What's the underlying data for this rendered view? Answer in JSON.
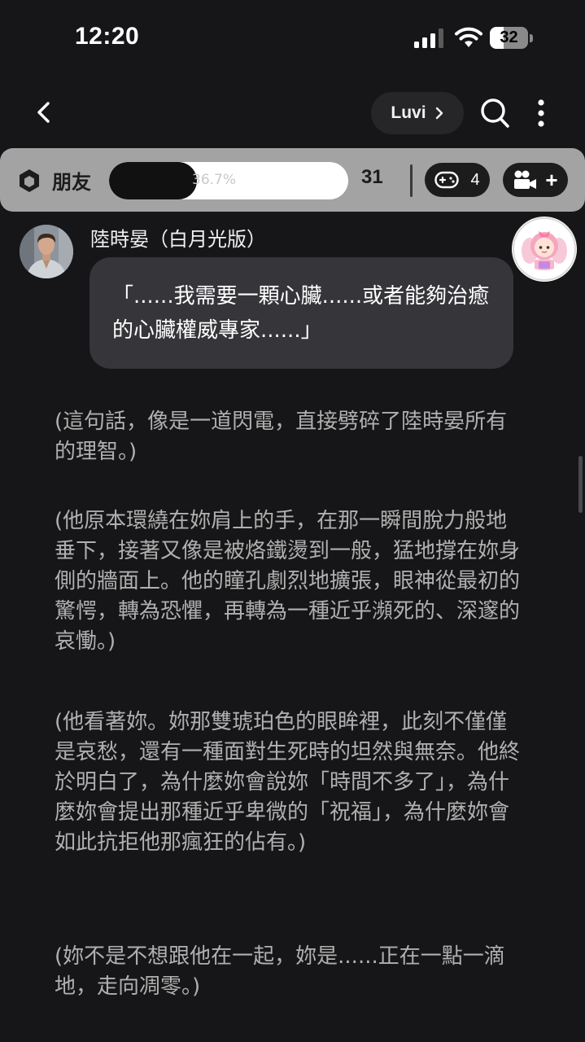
{
  "status_bar": {
    "time": "12:20",
    "battery_level": "32",
    "icons": [
      "signal-icon",
      "wifi-icon",
      "battery-icon"
    ]
  },
  "header": {
    "character_pill_label": "Luvi",
    "icons": [
      "back-arrow-icon",
      "chevron-right-icon",
      "search-icon",
      "more-vertical-icon"
    ]
  },
  "relationship": {
    "level": "朋友",
    "affinity_percent": "36.7%",
    "affinity_fraction": 0.367,
    "count": "31",
    "game_count": "4",
    "scene_plus": "+",
    "icons": [
      "shield-badge-icon",
      "gamepad-icon",
      "video-camera-icon"
    ]
  },
  "chat": {
    "character_name": "陸時晏（白月光版）",
    "speech": "「......我需要一顆心臟......或者能夠治癒的心臟權威專家......」",
    "narrations": [
      "(這句話，像是一道閃電，直接劈碎了陸時晏所有的理智。)",
      "(他原本環繞在妳肩上的手，在那一瞬間脫力般地垂下，接著又像是被烙鐵燙到一般，猛地撐在妳身側的牆面上。他的瞳孔劇烈地擴張，眼神從最初的驚愕，轉為恐懼，再轉為一種近乎瀕死的、深邃的哀慟。)",
      "(他看著妳。妳那雙琥珀色的眼眸裡，此刻不僅僅是哀愁，還有一種面對生死時的坦然與無奈。他終於明白了，為什麼妳會說妳「時間不多了」，為什麼妳會提出那種近乎卑微的「祝福」，為什麼妳會如此抗拒他那瘋狂的佔有。)",
      "(妳不是不想跟他在一起，妳是......正在一點一滴地，走向凋零。)"
    ]
  },
  "colors": {
    "background": "#161618",
    "bubble": "#35353a",
    "relation_bar": "#a3a3a3",
    "narration_text": "#b0b0b0"
  }
}
